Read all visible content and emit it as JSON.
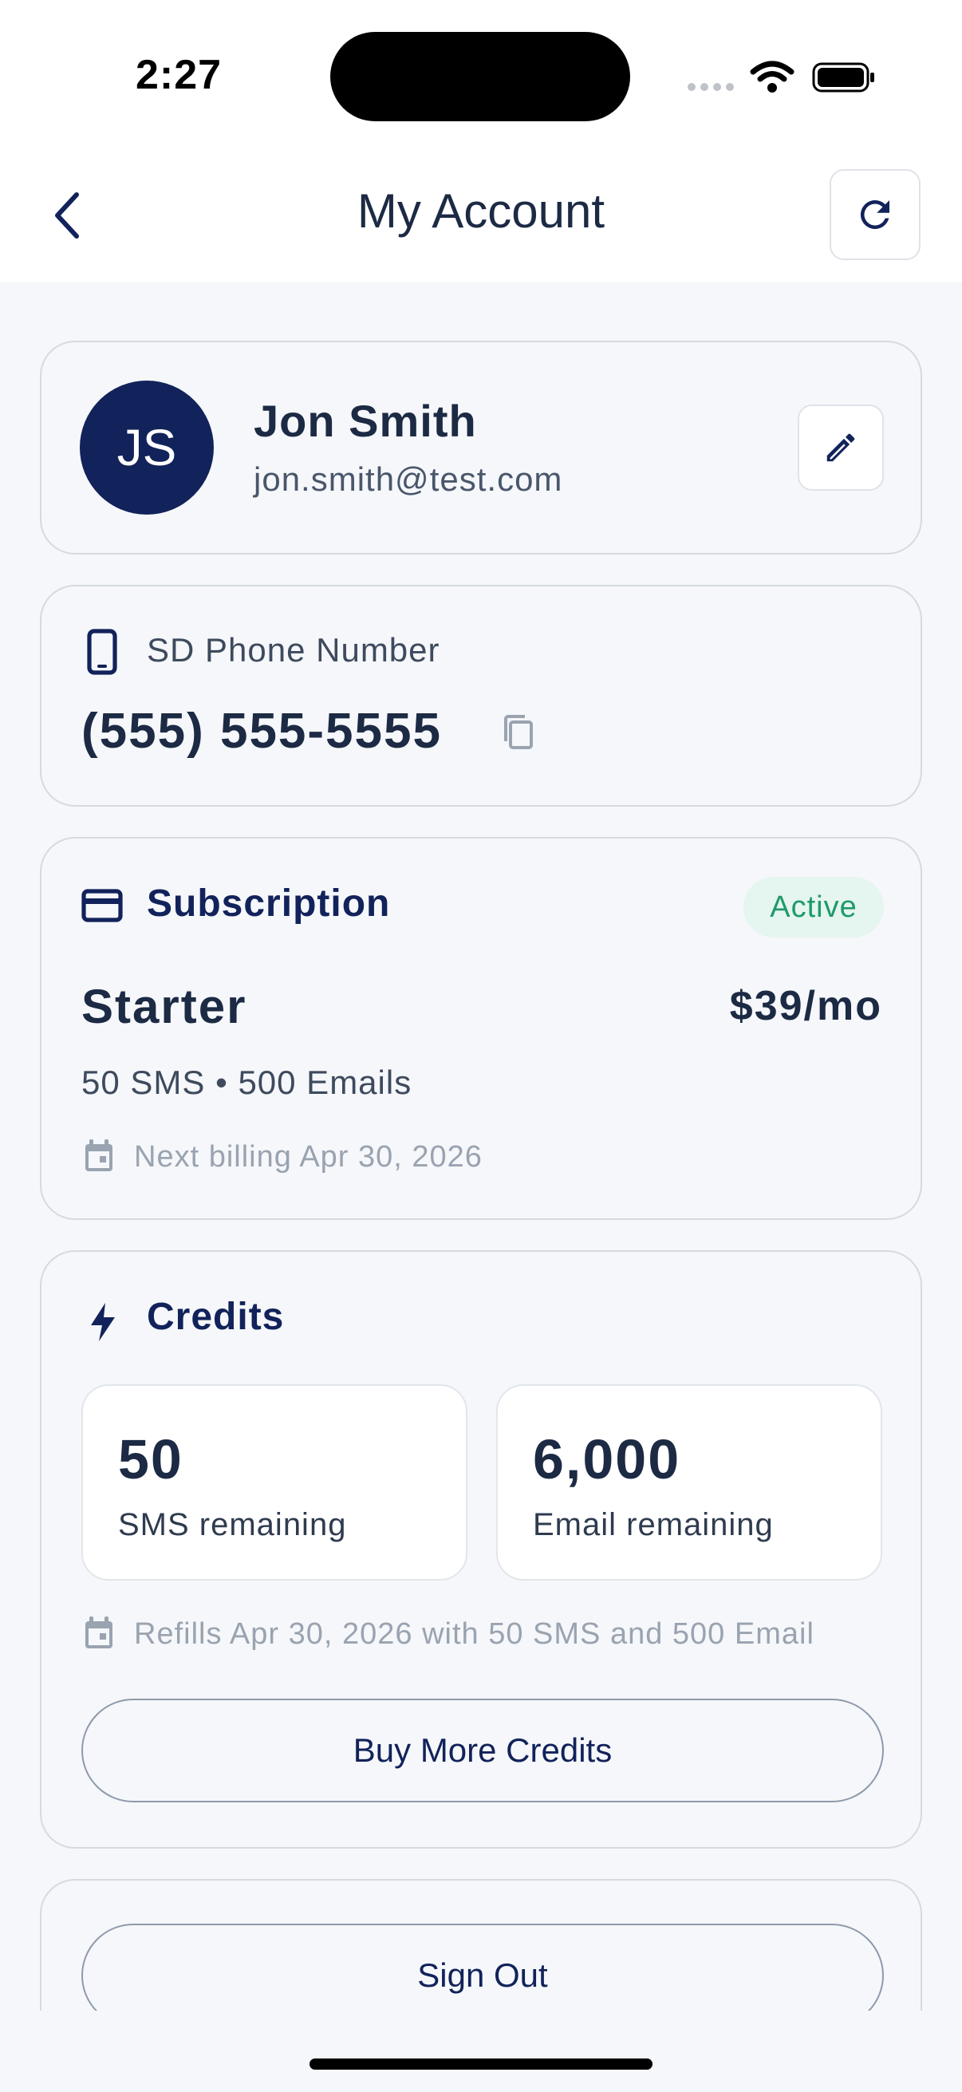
{
  "status_bar": {
    "time": "2:27"
  },
  "header": {
    "title": "My Account"
  },
  "profile": {
    "initials": "JS",
    "name": "Jon Smith",
    "email": "jon.smith@test.com"
  },
  "phone": {
    "label": "SD Phone Number",
    "number": "(555) 555-5555"
  },
  "subscription": {
    "title": "Subscription",
    "status": "Active",
    "plan": "Starter",
    "price": "$39/mo",
    "features": "50 SMS • 500 Emails",
    "next_billing": "Next billing Apr 30, 2026"
  },
  "credits": {
    "title": "Credits",
    "sms": {
      "value": "50",
      "label": "SMS remaining"
    },
    "email": {
      "value": "6,000",
      "label": "Email remaining"
    },
    "refill_note": "Refills Apr 30, 2026 with 50 SMS and 500 Email",
    "buy_label": "Buy More Credits"
  },
  "sign_out_label": "Sign Out",
  "colors": {
    "primary": "#12225a",
    "text": "#1c2a44",
    "success": "#1f9a6a",
    "background": "#f5f7fa"
  },
  "icons": [
    "chevron-left-icon",
    "refresh-icon",
    "pencil-icon",
    "phone-icon",
    "copy-icon",
    "credit-card-icon",
    "calendar-icon",
    "lightning-icon"
  ]
}
